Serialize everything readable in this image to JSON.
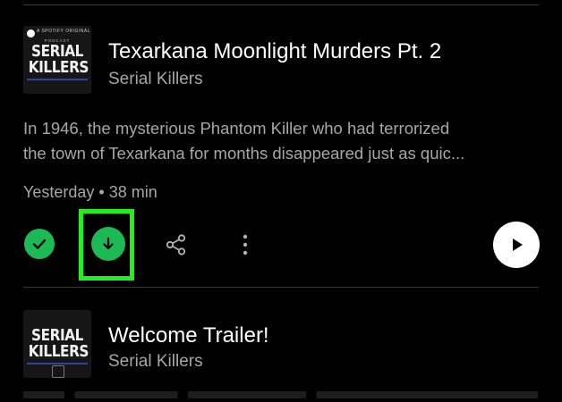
{
  "colors": {
    "background": "#000000",
    "accent_green": "#1db954",
    "highlight_box": "#22f01a",
    "secondary_text": "#a7a7a7"
  },
  "episodes": [
    {
      "cover": {
        "top_label": "A SPOTIFY ORIGINAL",
        "podcast_label": "PODCAST",
        "title_line1": "SERIAL",
        "title_line2": "KILLERS"
      },
      "title": "Texarkana Moonlight Murders Pt. 2",
      "show": "Serial Killers",
      "description_line1": "In 1946, the mysterious Phantom Killer who had terrorized",
      "description_line2": "the town of Texarkana for months disappeared just as quic...",
      "meta": "Yesterday • 38 min",
      "actions": {
        "added_icon": "check-icon",
        "download_icon": "download-arrow-icon",
        "share_icon": "share-icon",
        "more_icon": "more-vertical-icon",
        "play_icon": "play-icon"
      }
    },
    {
      "cover": {
        "title_line1": "SERIAL",
        "title_line2": "KILLERS"
      },
      "title": "Welcome Trailer!",
      "show": "Serial Killers"
    }
  ]
}
